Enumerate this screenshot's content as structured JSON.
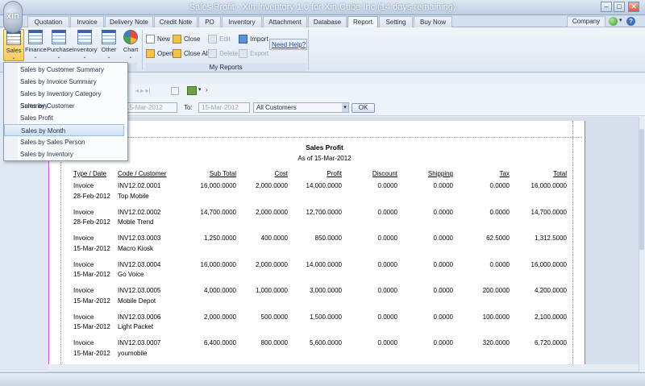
{
  "window": {
    "title": "Sales Profit - Xin Inventory 1.0 for Xin Cube Inc (14 days remaining)",
    "logo_text": "xin",
    "controls": [
      "–",
      "□",
      "✕"
    ]
  },
  "tabs": [
    "Quotation",
    "Invoice",
    "Delivery Note",
    "Credit Note",
    "PO",
    "Inventory",
    "Attachment",
    "Database",
    "Report",
    "Setting",
    "Buy Now"
  ],
  "active_tab": "Report",
  "company_label": "Company",
  "ribbon": {
    "report_buttons": [
      "Sales",
      "Finance",
      "Purchase",
      "Inventory",
      "Other",
      "Chart"
    ],
    "my_reports": {
      "new": "New",
      "open": "Open",
      "close": "Close",
      "close_all": "Close All",
      "edit": "Edit",
      "delete": "Delete",
      "import": "Import",
      "export": "Export",
      "need_help": "Need Help?",
      "group_label": "My Reports"
    }
  },
  "filter": {
    "from_date": "15-Mar-2012",
    "to_label": "To:",
    "to_date": "15-Mar-2012",
    "customer": "All Customers",
    "ok_label": "OK"
  },
  "sales_menu": [
    "Sales by Customer Summary",
    "Sales by Invoice Summary",
    "Sales by Inventory Category Summary",
    "Sales by Customer",
    "Sales Profit",
    "Sales by Month",
    "Sales by Sales Person",
    "Sales by Inventory"
  ],
  "sales_menu_hover": "Sales by Month",
  "report": {
    "title": "Sales Profit",
    "subtitle": "As of 15-Mar-2012",
    "headers": [
      "Type / Date",
      "Code / Customer",
      "Sub Total",
      "Cost",
      "Profit",
      "Discount",
      "Shipping",
      "Tax",
      "Total"
    ],
    "rows": [
      {
        "type": "Invoice",
        "date": "28-Feb-2012",
        "code": "INV12.02.0001",
        "customer": "Top Mobile",
        "subtotal": "16,000.0000",
        "cost": "2,000.0000",
        "profit": "14,000.0000",
        "discount": "0.0000",
        "shipping": "0.0000",
        "tax": "0.0000",
        "total": "16,000.0000"
      },
      {
        "type": "Invoice",
        "date": "28-Feb-2012",
        "code": "INV12.02.0002",
        "customer": "Moble Trend",
        "subtotal": "14,700.0000",
        "cost": "2,000.0000",
        "profit": "12,700.0000",
        "discount": "0.0000",
        "shipping": "0.0000",
        "tax": "0.0000",
        "total": "14,700.0000"
      },
      {
        "type": "Invoice",
        "date": "15-Mar-2012",
        "code": "INV12.03.0003",
        "customer": "Macro Kiosk",
        "subtotal": "1,250.0000",
        "cost": "400.0000",
        "profit": "850.0000",
        "discount": "0.0000",
        "shipping": "0.0000",
        "tax": "62.5000",
        "total": "1,312.5000"
      },
      {
        "type": "Invoice",
        "date": "15-Mar-2012",
        "code": "INV12.03.0004",
        "customer": "Go Voice",
        "subtotal": "16,000.0000",
        "cost": "2,000.0000",
        "profit": "14,000.0000",
        "discount": "0.0000",
        "shipping": "0.0000",
        "tax": "0.0000",
        "total": "16,000.0000"
      },
      {
        "type": "Invoice",
        "date": "15-Mar-2012",
        "code": "INV12.03.0005",
        "customer": "Mobile Depot",
        "subtotal": "4,000.0000",
        "cost": "1,000.0000",
        "profit": "3,000.0000",
        "discount": "0.0000",
        "shipping": "0.0000",
        "tax": "200.0000",
        "total": "4,200.0000"
      },
      {
        "type": "Invoice",
        "date": "15-Mar-2012",
        "code": "INV12.03.0006",
        "customer": "Light Packet",
        "subtotal": "2,000.0000",
        "cost": "500.0000",
        "profit": "1,500.0000",
        "discount": "0.0000",
        "shipping": "0.0000",
        "tax": "100.0000",
        "total": "2,100.0000"
      },
      {
        "type": "Invoice",
        "date": "15-Mar-2012",
        "code": "INV12.03.0007",
        "customer": "youmobile",
        "subtotal": "6,400.0000",
        "cost": "800.0000",
        "profit": "5,600.0000",
        "discount": "0.0000",
        "shipping": "0.0000",
        "tax": "320.0000",
        "total": "6,720.0000"
      }
    ]
  },
  "colors": {
    "accent": "#f9c95f",
    "page_border": "#c45bc2"
  }
}
